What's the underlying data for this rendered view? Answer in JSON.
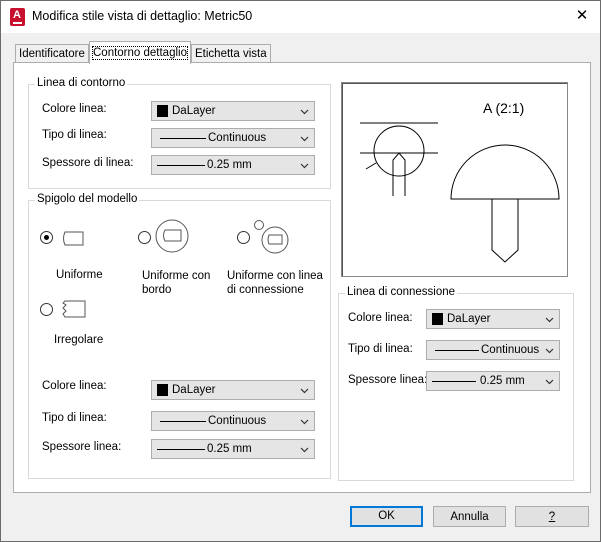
{
  "window": {
    "title": "Modifica stile vista di dettaglio: Metric50",
    "app_icon_letter": "A"
  },
  "tabs": [
    {
      "label": "Identificatore"
    },
    {
      "label": "Contorno dettaglio"
    },
    {
      "label": "Etichetta vista"
    }
  ],
  "boundary": {
    "title": "Linea di contorno",
    "color_label": "Colore linea:",
    "color_value": "DaLayer",
    "linetype_label": "Tipo di linea:",
    "linetype_value": "Continuous",
    "weight_label": "Spessore di linea:",
    "weight_value": "0.25 mm"
  },
  "model_edge": {
    "title": "Spigolo del modello",
    "options": [
      {
        "label": "Uniforme",
        "selected": true
      },
      {
        "label": "Uniforme con bordo",
        "selected": false
      },
      {
        "label": "Uniforme con linea di connessione",
        "selected": false
      },
      {
        "label": "Irregolare",
        "selected": false
      }
    ],
    "color_label": "Colore linea:",
    "color_value": "DaLayer",
    "linetype_label": "Tipo di linea:",
    "linetype_value": "Continuous",
    "weight_label": "Spessore linea:",
    "weight_value": "0.25 mm"
  },
  "preview": {
    "caption": "A (2:1)"
  },
  "connection": {
    "title": "Linea di connessione",
    "color_label": "Colore linea:",
    "color_value": "DaLayer",
    "linetype_label": "Tipo di linea:",
    "linetype_value": "Continuous",
    "weight_label": "Spessore linea:",
    "weight_value": "0.25 mm"
  },
  "buttons": {
    "ok": "OK",
    "cancel": "Annulla",
    "help": "?"
  },
  "colors": {
    "accent": "#0078d7",
    "app_icon": "#c8102e"
  }
}
